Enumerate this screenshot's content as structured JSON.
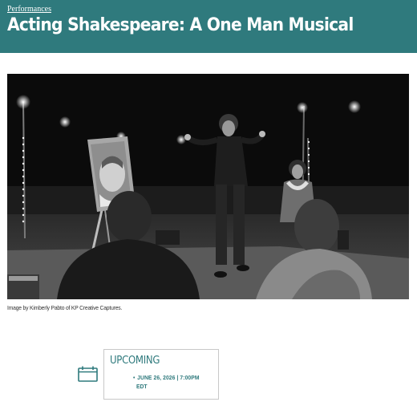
{
  "header": {
    "breadcrumb": "Performances",
    "title": "Acting Shakespeare: A One Man Musical"
  },
  "photo": {
    "caption": "Image by Kimberly Pabto of KP Creative Captures."
  },
  "event": {
    "status": "UPCOMING",
    "date_time": "JUNE 26, 2026 | 7:00PM",
    "timezone": "EDT",
    "icon": "calendar-icon"
  },
  "colors": {
    "header_bg": "#2f7a7d",
    "accent": "#2f7a7d"
  }
}
